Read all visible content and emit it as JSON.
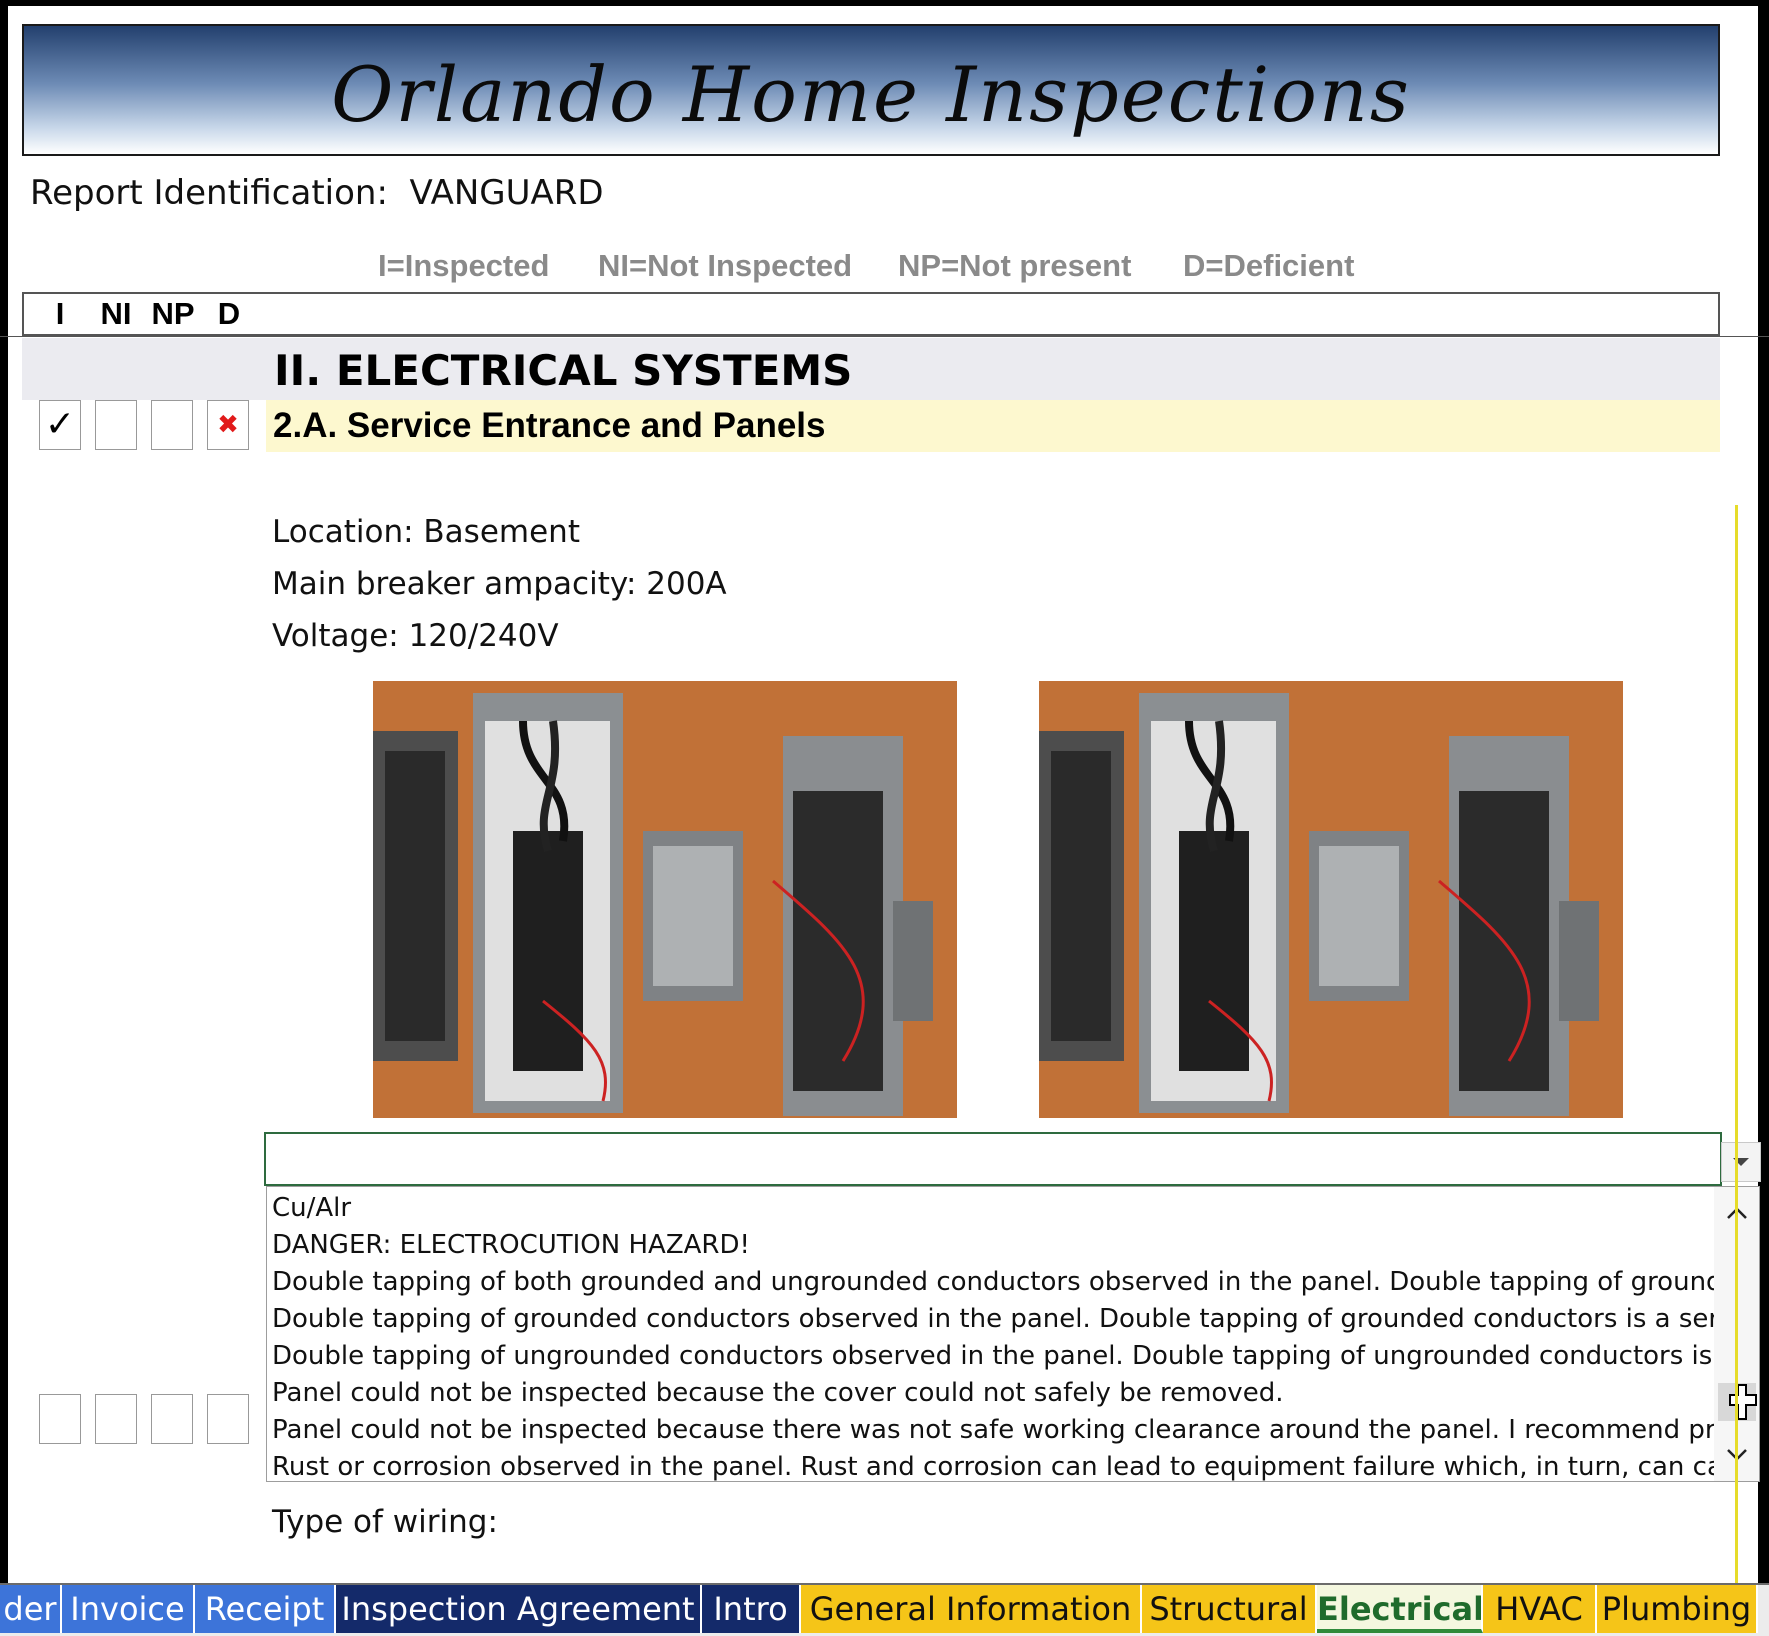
{
  "banner": {
    "title": "Orlando Home Inspections"
  },
  "report": {
    "label": "Report Identification:",
    "value": "VANGUARD"
  },
  "legend": {
    "inspected": "I=Inspected",
    "not_inspected": "NI=Not Inspected",
    "not_present": "NP=Not present",
    "deficient": "D=Deficient"
  },
  "columns": {
    "i": "I",
    "ni": "NI",
    "np": "NP",
    "d": "D"
  },
  "section": {
    "title": "II. ELECTRICAL SYSTEMS",
    "subsection": {
      "title": "2.A. Service Entrance and Panels",
      "checks": {
        "I": "✓",
        "NI": "",
        "NP": "",
        "D": "✖"
      }
    }
  },
  "details": {
    "location": "Location: Basement",
    "main_breaker": "Main breaker ampacity: 200A",
    "voltage": "Voltage: 120/240V"
  },
  "dropdown": {
    "value": "",
    "options": [
      "Cu/Alr",
      "DANGER: ELECTROCUTION HAZARD!",
      "Double tapping of both grounded and ungrounded conductors observed in the panel. Double tapping of grounded and u",
      "Double tapping of grounded conductors observed in the panel. Double tapping of grounded conductors is a serious electr",
      "Double tapping of ungrounded conductors observed in the panel. Double tapping of ungrounded conductors is a serious e",
      "Panel could not be inspected because the cover could not safely be removed.",
      "Panel could not be inspected because there was not safe working clearance around the panel. I recommend providing safe",
      "Rust or corrosion observed in the panel. Rust and corrosion can lead to equipment failure which, in turn, can cause a fire or"
    ]
  },
  "type_of_wiring": {
    "label": "Type of wiring:"
  },
  "tabs": [
    {
      "label": "der"
    },
    {
      "label": "Invoice"
    },
    {
      "label": "Receipt"
    },
    {
      "label": "Inspection Agreement"
    },
    {
      "label": "Intro"
    },
    {
      "label": "General Information"
    },
    {
      "label": "Structural"
    },
    {
      "label": "Electrical"
    },
    {
      "label": "HVAC"
    },
    {
      "label": "Plumbing"
    }
  ],
  "active_tab": "Electrical",
  "colors": {
    "banner_gradient_top": "#23406e",
    "section_band": "#ebebf0",
    "subsection_band": "#fdf8cf",
    "deficient_mark": "#e11a1a",
    "tab_blue": "#3d74d9",
    "tab_navy": "#142a6a",
    "tab_yellow": "#f5c518",
    "active_tab_text": "#1f6b2c"
  },
  "icons": {
    "checkmark": "check-icon",
    "deficient": "x-mark-icon",
    "dropdown": "chevron-down-icon",
    "scroll_up": "chevron-up-icon",
    "scroll_down": "chevron-down-icon",
    "cursor": "move-cursor-icon"
  }
}
